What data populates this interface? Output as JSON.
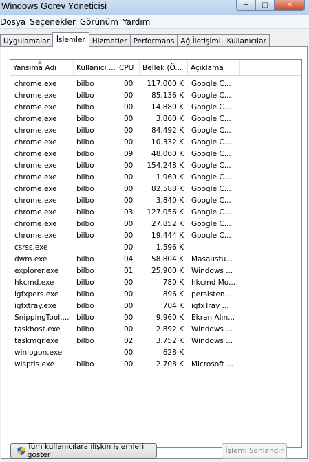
{
  "window": {
    "title": "Windows Görev Yöneticisi"
  },
  "menu": [
    "Dosya",
    "Seçenekler",
    "Görünüm",
    "Yardım"
  ],
  "tabs": [
    "Uygulamalar",
    "İşlemler",
    "Hizmetler",
    "Performans",
    "Ağ İletişimi",
    "Kullanıcılar"
  ],
  "active_tab": "İşlemler",
  "columns": [
    "Yansıma Adı",
    "Kullanıcı ...",
    "CPU",
    "Bellek (Ö...",
    "Açıklama"
  ],
  "sort_column": "Yansıma Adı",
  "processes": [
    {
      "name": "chrome.exe",
      "user": "bilbo",
      "cpu": "00",
      "mem": "117.000 K",
      "desc": "Google C..."
    },
    {
      "name": "chrome.exe",
      "user": "bilbo",
      "cpu": "00",
      "mem": "85.136 K",
      "desc": "Google C..."
    },
    {
      "name": "chrome.exe",
      "user": "bilbo",
      "cpu": "00",
      "mem": "14.880 K",
      "desc": "Google C..."
    },
    {
      "name": "chrome.exe",
      "user": "bilbo",
      "cpu": "00",
      "mem": "3.860 K",
      "desc": "Google C..."
    },
    {
      "name": "chrome.exe",
      "user": "bilbo",
      "cpu": "00",
      "mem": "84.492 K",
      "desc": "Google C..."
    },
    {
      "name": "chrome.exe",
      "user": "bilbo",
      "cpu": "00",
      "mem": "10.332 K",
      "desc": "Google C..."
    },
    {
      "name": "chrome.exe",
      "user": "bilbo",
      "cpu": "09",
      "mem": "48.060 K",
      "desc": "Google C..."
    },
    {
      "name": "chrome.exe",
      "user": "bilbo",
      "cpu": "00",
      "mem": "154.248 K",
      "desc": "Google C..."
    },
    {
      "name": "chrome.exe",
      "user": "bilbo",
      "cpu": "00",
      "mem": "1.960 K",
      "desc": "Google C..."
    },
    {
      "name": "chrome.exe",
      "user": "bilbo",
      "cpu": "00",
      "mem": "82.588 K",
      "desc": "Google C..."
    },
    {
      "name": "chrome.exe",
      "user": "bilbo",
      "cpu": "00",
      "mem": "3.840 K",
      "desc": "Google C..."
    },
    {
      "name": "chrome.exe",
      "user": "bilbo",
      "cpu": "03",
      "mem": "127.056 K",
      "desc": "Google C..."
    },
    {
      "name": "chrome.exe",
      "user": "bilbo",
      "cpu": "00",
      "mem": "27.852 K",
      "desc": "Google C..."
    },
    {
      "name": "chrome.exe",
      "user": "bilbo",
      "cpu": "00",
      "mem": "19.444 K",
      "desc": "Google C..."
    },
    {
      "name": "csrss.exe",
      "user": "",
      "cpu": "00",
      "mem": "1.596 K",
      "desc": ""
    },
    {
      "name": "dwm.exe",
      "user": "bilbo",
      "cpu": "04",
      "mem": "58.804 K",
      "desc": "Masaüstü..."
    },
    {
      "name": "explorer.exe",
      "user": "bilbo",
      "cpu": "01",
      "mem": "25.900 K",
      "desc": "Windows ..."
    },
    {
      "name": "hkcmd.exe",
      "user": "bilbo",
      "cpu": "00",
      "mem": "780 K",
      "desc": "hkcmd Mo..."
    },
    {
      "name": "igfxpers.exe",
      "user": "bilbo",
      "cpu": "00",
      "mem": "896 K",
      "desc": "persisten..."
    },
    {
      "name": "igfxtray.exe",
      "user": "bilbo",
      "cpu": "00",
      "mem": "704 K",
      "desc": "igfxTray ..."
    },
    {
      "name": "SnippingTool....",
      "user": "bilbo",
      "cpu": "00",
      "mem": "9.960 K",
      "desc": "Ekran Alın..."
    },
    {
      "name": "taskhost.exe",
      "user": "bilbo",
      "cpu": "00",
      "mem": "2.892 K",
      "desc": "Windows ..."
    },
    {
      "name": "taskmgr.exe",
      "user": "bilbo",
      "cpu": "02",
      "mem": "3.752 K",
      "desc": "Windows ..."
    },
    {
      "name": "winlogon.exe",
      "user": "",
      "cpu": "00",
      "mem": "628 K",
      "desc": ""
    },
    {
      "name": "wisptis.exe",
      "user": "bilbo",
      "cpu": "00",
      "mem": "2.708 K",
      "desc": "Microsoft ..."
    }
  ],
  "buttons": {
    "show_all": "Tüm kullanıcılara ilişkin işlemleri göster",
    "end_process": "İşlemi Sonlandır"
  },
  "icons": {
    "show_all_button_icon": "uac-shield-icon"
  }
}
